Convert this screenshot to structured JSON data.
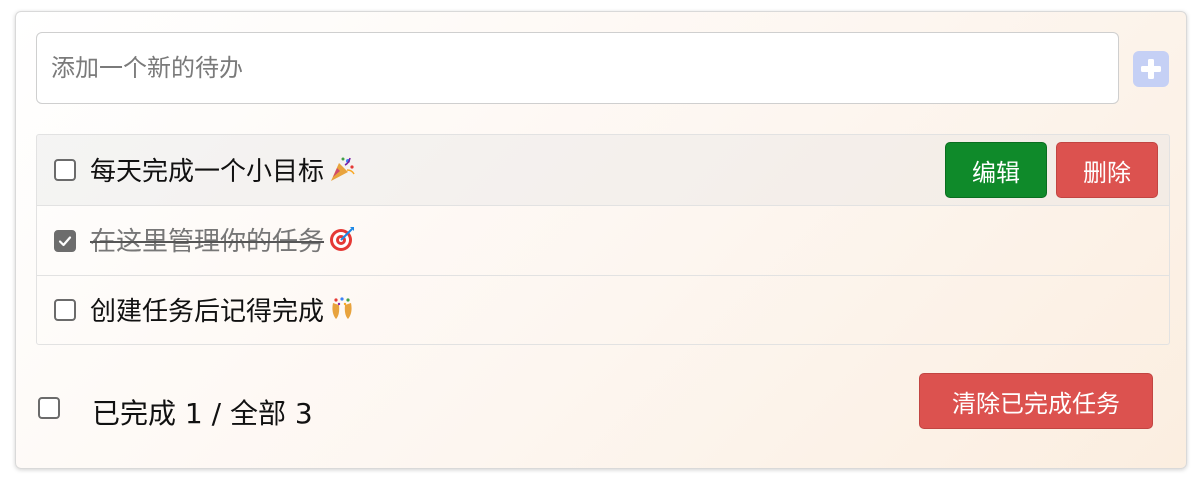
{
  "new_todo": {
    "placeholder": "添加一个新的待办",
    "add_icon": "plus-icon"
  },
  "todos": [
    {
      "text": "每天完成一个小目标",
      "emoji": "party-popper-icon",
      "completed": false,
      "hovered": true
    },
    {
      "text": "在这里管理你的任务",
      "emoji": "target-icon",
      "completed": true,
      "hovered": false
    },
    {
      "text": "创建任务后记得完成",
      "emoji": "confetti-icon",
      "completed": false,
      "hovered": false
    }
  ],
  "actions": {
    "edit_label": "编辑",
    "delete_label": "删除"
  },
  "footer": {
    "select_all_checked": false,
    "summary": "已完成 1 / 全部 3",
    "clear_label": "清除已完成任务"
  },
  "colors": {
    "edit_button": "#0f8a2a",
    "delete_button": "#dc524f",
    "add_button": "#c5d0f5"
  }
}
